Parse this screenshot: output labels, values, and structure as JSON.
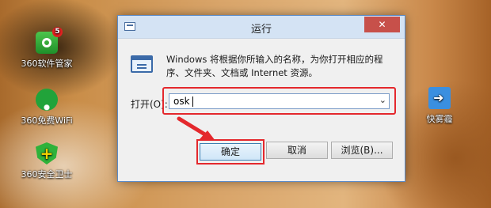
{
  "desktop": {
    "icons": [
      {
        "label": "360软件管家",
        "icon": "360-software-manager-icon",
        "badge": "5"
      },
      {
        "label": "360免费WiFi",
        "icon": "wifi-icon"
      },
      {
        "label": "360安全卫士",
        "icon": "360-security-shield-icon"
      },
      {
        "label": "快雾霾",
        "icon": "shortcut-icon"
      }
    ]
  },
  "dialog": {
    "title": "运行",
    "close_label": "✕",
    "description": "Windows 将根据你所输入的名称，为你打开相应的程序、文件夹、文档或 Internet 资源。",
    "open_label": "打开(O):",
    "input_value": "osk",
    "ok_label": "确定",
    "cancel_label": "取消",
    "browse_label": "浏览(B)..."
  },
  "annotation_color": "#e4282d"
}
